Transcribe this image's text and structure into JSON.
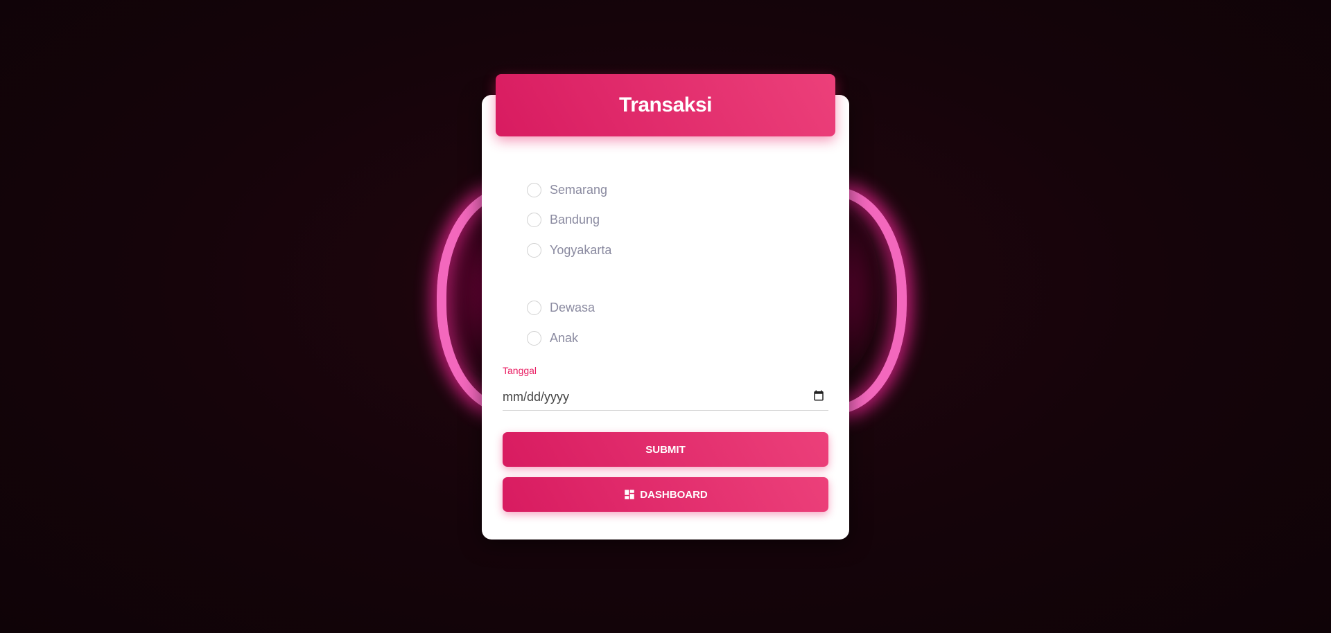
{
  "form": {
    "title": "Transaksi",
    "city_options": [
      "Semarang",
      "Bandung",
      "Yogyakarta"
    ],
    "age_options": [
      "Dewasa",
      "Anak"
    ],
    "date": {
      "label": "Tanggal",
      "placeholder": "mm/dd/yyyy"
    },
    "submit_label": "SUBMIT",
    "dashboard_label": "DASHBOARD"
  },
  "icons": {
    "calendar": "calendar-icon",
    "dashboard": "dashboard-icon"
  },
  "colors": {
    "accent": "#e91e63",
    "accent_light": "#ec407a",
    "background": "#15040a",
    "neon": "#ff6ec7",
    "card": "#ffffff"
  }
}
